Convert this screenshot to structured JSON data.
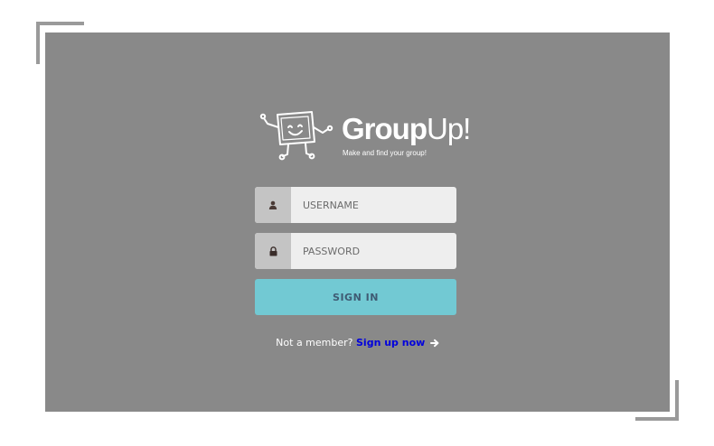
{
  "brand": {
    "name_part1": "Group",
    "name_part2": "Up!",
    "tagline": "Make and find your group!"
  },
  "login": {
    "username_placeholder": "USERNAME",
    "password_placeholder": "PASSWORD",
    "signin_label": "SIGN IN"
  },
  "footer": {
    "prompt": "Not a member?",
    "signup_label": "Sign up now"
  },
  "icons": {
    "username": "user-icon",
    "password": "lock-icon",
    "signup": "arrow-right-icon"
  },
  "colors": {
    "panel": "#898989",
    "signin_button": "#72c9d3",
    "signup_link": "#0000dd"
  }
}
